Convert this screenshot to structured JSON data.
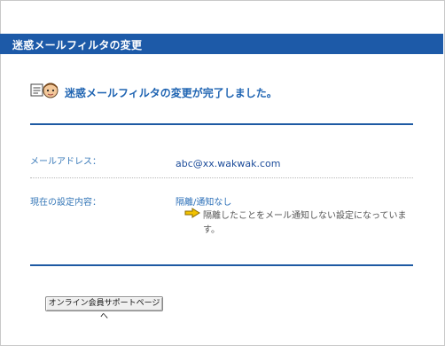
{
  "header": {
    "title": "迷惑メールフィルタの変更"
  },
  "status": {
    "message": "迷惑メールフィルタの変更が完了しました。",
    "icon": "mail-person-icon"
  },
  "email": {
    "label": "メールアドレス：",
    "value": "abc@xx.wakwak.com"
  },
  "setting": {
    "label": "現在の設定内容：",
    "value": "隔離/通知なし",
    "icon": "arrow-right-icon",
    "note": "隔離したことをメール通知しない設定になっています。"
  },
  "footer": {
    "button_label": "オンライン会員サポートページへ"
  },
  "colors": {
    "header_bg": "#1d5aa8",
    "accent": "#1f64b2",
    "label": "#3778b8",
    "arrow": "#f2c200"
  }
}
